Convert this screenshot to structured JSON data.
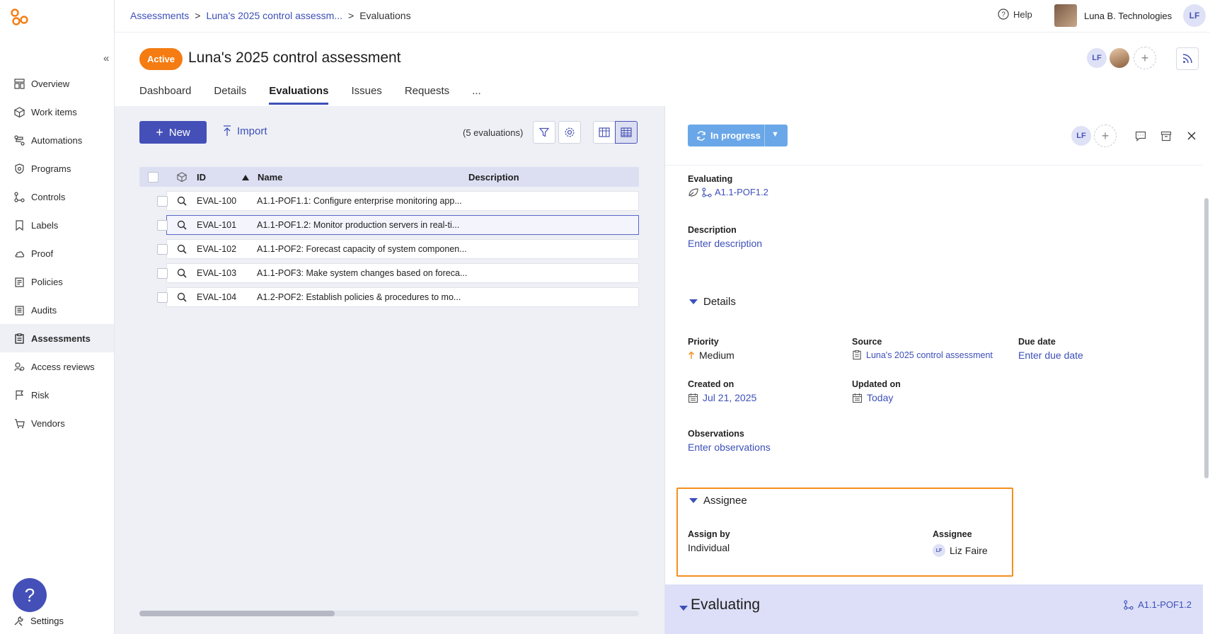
{
  "breadcrumb": [
    "Assessments",
    "Luna's 2025 control assessm...",
    "Evaluations"
  ],
  "breadcrumb_sep": ">",
  "topbar": {
    "help": "Help",
    "org_name": "Luna B. Technologies",
    "user_initials": "LF"
  },
  "sidebar": {
    "items": [
      {
        "label": "Overview",
        "icon": "overview-icon"
      },
      {
        "label": "Work items",
        "icon": "work-items-icon"
      },
      {
        "label": "Automations",
        "icon": "automations-icon"
      },
      {
        "label": "Programs",
        "icon": "programs-icon"
      },
      {
        "label": "Controls",
        "icon": "controls-icon"
      },
      {
        "label": "Labels",
        "icon": "labels-icon"
      },
      {
        "label": "Proof",
        "icon": "proof-icon"
      },
      {
        "label": "Policies",
        "icon": "policies-icon"
      },
      {
        "label": "Audits",
        "icon": "audits-icon"
      },
      {
        "label": "Assessments",
        "icon": "assessments-icon",
        "active": true
      },
      {
        "label": "Access reviews",
        "icon": "access-reviews-icon"
      },
      {
        "label": "Risk",
        "icon": "risk-icon"
      },
      {
        "label": "Vendors",
        "icon": "vendors-icon"
      }
    ],
    "settings": "Settings",
    "help_fab": "?"
  },
  "page": {
    "status": "Active",
    "title": "Luna's 2025 control assessment",
    "owner_initials": "LF",
    "tabs": [
      "Dashboard",
      "Details",
      "Evaluations",
      "Issues",
      "Requests",
      "..."
    ],
    "active_tab": "Evaluations"
  },
  "toolbar": {
    "new_label": "New",
    "import_label": "Import",
    "count": "(5 evaluations)"
  },
  "table": {
    "headers": {
      "id": "ID",
      "name": "Name",
      "description": "Description"
    },
    "rows": [
      {
        "id": "EVAL-100",
        "name": "A1.1-POF1.1: Configure enterprise monitoring app..."
      },
      {
        "id": "EVAL-101",
        "name": "A1.1-POF1.2: Monitor production servers in real-ti...",
        "selected": true
      },
      {
        "id": "EVAL-102",
        "name": "A1.1-POF2: Forecast capacity of system componen..."
      },
      {
        "id": "EVAL-103",
        "name": "A1.1-POF3: Make system changes based on foreca..."
      },
      {
        "id": "EVAL-104",
        "name": "A1.2-POF2: Establish policies & procedures to mo..."
      }
    ]
  },
  "panel": {
    "status": "In progress",
    "owner_initials": "LF",
    "evaluating_label": "Evaluating",
    "evaluating_value": "A1.1-POF1.2",
    "description_label": "Description",
    "description_value": "Enter description",
    "details_label": "Details",
    "priority_label": "Priority",
    "priority_value": "Medium",
    "source_label": "Source",
    "source_value": "Luna's 2025 control assessment",
    "due_label": "Due date",
    "due_value": "Enter due date",
    "created_label": "Created on",
    "created_value": "Jul 21, 2025",
    "updated_label": "Updated on",
    "updated_value": "Today",
    "observations_label": "Observations",
    "observations_value": "Enter observations",
    "assignee_section": "Assignee",
    "assign_by_label": "Assign by",
    "assign_by_value": "Individual",
    "assignee_label": "Assignee",
    "assignee_value": "Liz Faire",
    "assignee_initials": "LF",
    "footer_title": "Evaluating",
    "footer_value": "A1.1-POF1.2"
  },
  "colors": {
    "accent": "#4450b8",
    "status_active": "#f47c12",
    "in_progress": "#6aa7e8",
    "highlight": "#f4901e"
  }
}
